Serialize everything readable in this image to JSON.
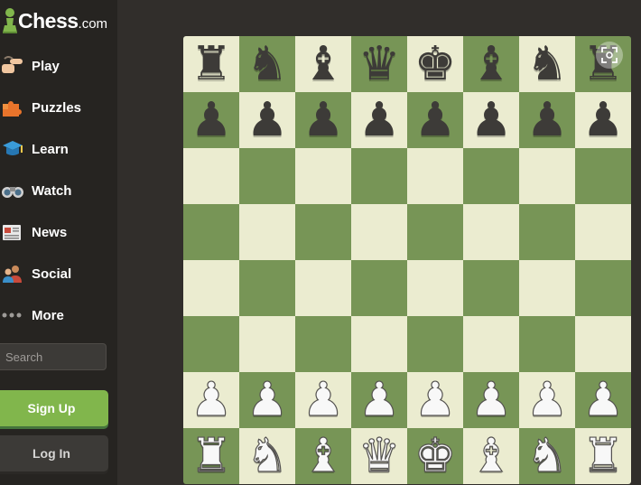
{
  "brand": {
    "name": "Chess",
    "suffix": ".com"
  },
  "nav": [
    {
      "label": "Play",
      "icon": "play-hand-icon"
    },
    {
      "label": "Puzzles",
      "icon": "puzzle-piece-icon"
    },
    {
      "label": "Learn",
      "icon": "graduation-cap-icon"
    },
    {
      "label": "Watch",
      "icon": "binoculars-icon"
    },
    {
      "label": "News",
      "icon": "newspaper-icon"
    },
    {
      "label": "Social",
      "icon": "people-icon"
    },
    {
      "label": "More",
      "icon": "ellipsis-icon"
    }
  ],
  "search": {
    "placeholder": "Search"
  },
  "buttons": {
    "signup": "Sign Up",
    "login": "Log In"
  },
  "board": {
    "orientation": "white-bottom",
    "colors": {
      "light": "#ebecd0",
      "dark": "#779556",
      "accent": "#81b64c"
    },
    "rows": [
      [
        "♜",
        "♞",
        "♝",
        "♛",
        "♚",
        "♝",
        "♞",
        "♜"
      ],
      [
        "♟",
        "♟",
        "♟",
        "♟",
        "♟",
        "♟",
        "♟",
        "♟"
      ],
      [
        "",
        "",
        "",
        "",
        "",
        "",
        "",
        ""
      ],
      [
        "",
        "",
        "",
        "",
        "",
        "",
        "",
        ""
      ],
      [
        "",
        "",
        "",
        "",
        "",
        "",
        "",
        ""
      ],
      [
        "",
        "",
        "",
        "",
        "",
        "",
        "",
        ""
      ],
      [
        "♟",
        "♟",
        "♟",
        "♟",
        "♟",
        "♟",
        "♟",
        "♟"
      ],
      [
        "♜",
        "♞",
        "♝",
        "♛",
        "♚",
        "♝",
        "♞",
        "♜"
      ]
    ],
    "colors_by_row": [
      "b",
      "b",
      "",
      "",
      "",
      "",
      "w",
      "w"
    ],
    "overlay_button_icon": "focus-icon"
  }
}
